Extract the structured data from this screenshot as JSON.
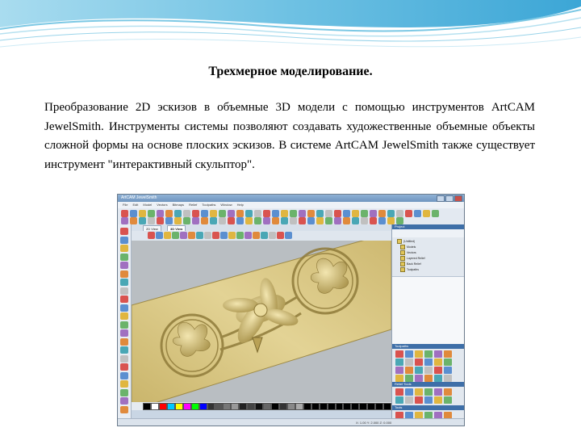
{
  "slide": {
    "title": "Трехмерное моделирование.",
    "paragraph": "Преобразование 2D эскизов в объемные 3D модели с помощью инструментов ArtCAM JewelSmith. Инструменты системы позволяют создавать художественные объемные объекты сложной формы на основе плоских эскизов. В системе ArtCAM JewelSmith также существует инструмент \"интерактивный скульптор\"."
  },
  "app": {
    "window_title": "ArtCAM JewelSmith",
    "menu": [
      "File",
      "Edit",
      "Model",
      "Vectors",
      "Bitmaps",
      "Relief",
      "Toolpaths",
      "Window",
      "Help"
    ],
    "doc_tabs": [
      "2D View",
      "3D View"
    ],
    "panels": {
      "project": "Project",
      "tree": [
        "(Untitled)",
        "Models",
        "Vectors",
        "Layered Relief",
        "Back Relief",
        "Toolpaths"
      ],
      "toolpaths": "Toolpaths",
      "tools_a": "Relief Tools",
      "tools_b": "Tools"
    },
    "status_coords": "X: 1.00   Y: 2.000   Z: 0.000"
  },
  "colors": {
    "accent_blue": "#3e6fa8",
    "relief_gold": "#d8c47c",
    "palette": [
      "#000000",
      "#ffffff",
      "#ff0000",
      "#00c8ff",
      "#ffff00",
      "#ff00ff",
      "#00ff00",
      "#0000ff",
      "#333333",
      "#555555",
      "#777777",
      "#999999",
      "#222222",
      "#444444",
      "#111111",
      "#666666",
      "#000000",
      "#333333",
      "#888888",
      "#aaaaaa",
      "#000000",
      "#000000",
      "#000000",
      "#000000",
      "#000000",
      "#000000",
      "#000000",
      "#000000",
      "#000000",
      "#000000",
      "#000000"
    ]
  }
}
